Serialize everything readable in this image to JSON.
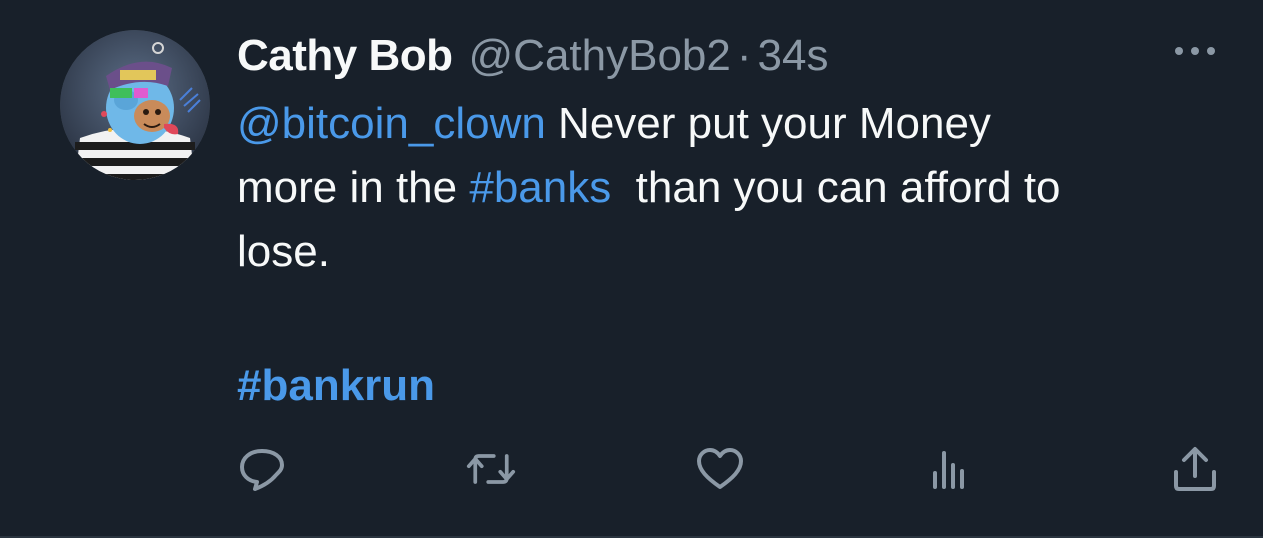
{
  "tweet": {
    "author": {
      "display_name": "Cathy Bob",
      "handle": "@CathyBob2",
      "avatar_icon": "avatar-image"
    },
    "separator": "·",
    "time": "34s",
    "more_icon": "more-dots-icon",
    "text": {
      "mention": "@bitcoin_clown",
      "part1": " Never put your Money",
      "part2": "more in the ",
      "hashtag_banks": "#banks",
      "part3": "  than you can afford to",
      "part4": "lose."
    },
    "hashtag_footer": "#bankrun",
    "actions": [
      {
        "name": "reply",
        "icon": "reply-icon"
      },
      {
        "name": "retweet",
        "icon": "retweet-icon"
      },
      {
        "name": "like",
        "icon": "heart-icon"
      },
      {
        "name": "views",
        "icon": "analytics-icon"
      },
      {
        "name": "share",
        "icon": "share-icon"
      }
    ]
  },
  "colors": {
    "background": "#18202a",
    "text_primary": "#f7f9f9",
    "text_secondary": "#8b98a5",
    "link": "#4a99e9",
    "icon": "#8b98a5"
  }
}
